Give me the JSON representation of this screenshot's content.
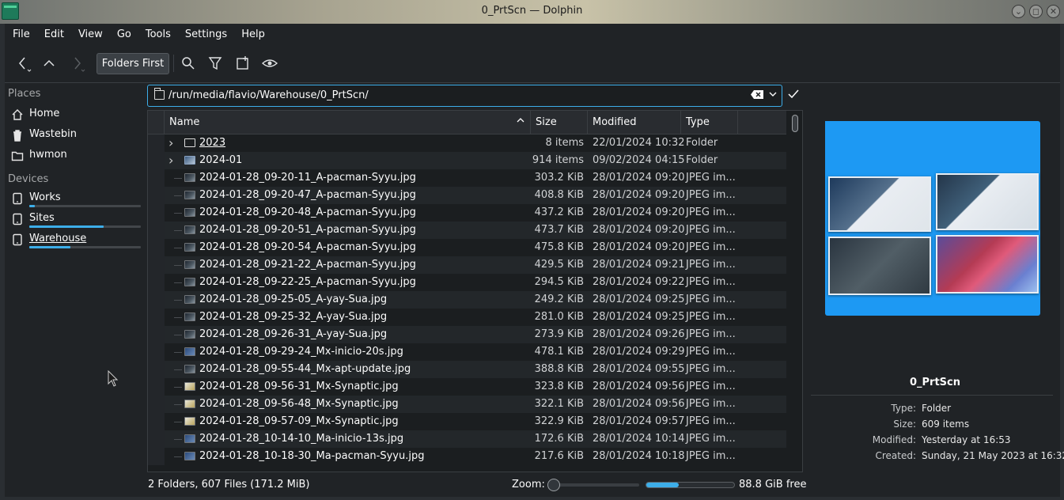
{
  "window": {
    "title": "0_PrtScn — Dolphin",
    "controls": [
      "minimize",
      "maximize",
      "close"
    ]
  },
  "menu": [
    "File",
    "Edit",
    "View",
    "Go",
    "Tools",
    "Settings",
    "Help"
  ],
  "toolbar": {
    "folders_first_label": "Folders First",
    "icons": [
      "back-icon",
      "up-icon",
      "forward-icon",
      "search-icon",
      "filter-icon",
      "new-tab-icon",
      "preview-icon"
    ]
  },
  "places": {
    "places_header": "Places",
    "devices_header": "Devices",
    "items": [
      {
        "label": "Home",
        "icon": "home-icon"
      },
      {
        "label": "Wastebin",
        "icon": "trash-icon"
      },
      {
        "label": "hwmon",
        "icon": "folder-icon"
      }
    ],
    "devices": [
      {
        "label": "Works",
        "icon": "drive-icon",
        "used_fraction": 0.05
      },
      {
        "label": "Sites",
        "icon": "drive-icon",
        "used_fraction": 0.67
      },
      {
        "label": "Warehouse",
        "icon": "drive-icon",
        "used_fraction": 0.37
      }
    ]
  },
  "location": {
    "path": "/run/media/flavio/Warehouse/0_PrtScn/"
  },
  "columns": {
    "name": "Name",
    "size": "Size",
    "modified": "Modified",
    "type": "Type"
  },
  "files": [
    {
      "name": "2023",
      "size": "8 items",
      "modified": "22/01/2024 10:32",
      "type": "Folder",
      "kind": "folder",
      "expandable": true
    },
    {
      "name": "2024-01",
      "size": "914 items",
      "modified": "09/02/2024 04:15",
      "type": "Folder",
      "kind": "folder-image",
      "expandable": true
    },
    {
      "name": "2024-01-28_09-20-11_A-pacman-Syyu.jpg",
      "size": "303.2 KiB",
      "modified": "28/01/2024 09:20",
      "type": "JPEG im...",
      "kind": "img"
    },
    {
      "name": "2024-01-28_09-20-47_A-pacman-Syyu.jpg",
      "size": "408.8 KiB",
      "modified": "28/01/2024 09:20",
      "type": "JPEG im...",
      "kind": "img"
    },
    {
      "name": "2024-01-28_09-20-48_A-pacman-Syyu.jpg",
      "size": "437.2 KiB",
      "modified": "28/01/2024 09:20",
      "type": "JPEG im...",
      "kind": "img"
    },
    {
      "name": "2024-01-28_09-20-51_A-pacman-Syyu.jpg",
      "size": "473.7 KiB",
      "modified": "28/01/2024 09:20",
      "type": "JPEG im...",
      "kind": "img"
    },
    {
      "name": "2024-01-28_09-20-54_A-pacman-Syyu.jpg",
      "size": "475.8 KiB",
      "modified": "28/01/2024 09:20",
      "type": "JPEG im...",
      "kind": "img"
    },
    {
      "name": "2024-01-28_09-21-22_A-pacman-Syyu.jpg",
      "size": "429.5 KiB",
      "modified": "28/01/2024 09:21",
      "type": "JPEG im...",
      "kind": "img"
    },
    {
      "name": "2024-01-28_09-22-25_A-pacman-Syyu.jpg",
      "size": "294.5 KiB",
      "modified": "28/01/2024 09:22",
      "type": "JPEG im...",
      "kind": "img"
    },
    {
      "name": "2024-01-28_09-25-05_A-yay-Sua.jpg",
      "size": "249.2 KiB",
      "modified": "28/01/2024 09:25",
      "type": "JPEG im...",
      "kind": "img"
    },
    {
      "name": "2024-01-28_09-25-32_A-yay-Sua.jpg",
      "size": "281.0 KiB",
      "modified": "28/01/2024 09:25",
      "type": "JPEG im...",
      "kind": "img"
    },
    {
      "name": "2024-01-28_09-26-31_A-yay-Sua.jpg",
      "size": "273.9 KiB",
      "modified": "28/01/2024 09:26",
      "type": "JPEG im...",
      "kind": "img"
    },
    {
      "name": "2024-01-28_09-29-24_Mx-inicio-20s.jpg",
      "size": "478.1 KiB",
      "modified": "28/01/2024 09:29",
      "type": "JPEG im...",
      "kind": "imgb"
    },
    {
      "name": "2024-01-28_09-55-44_Mx-apt-update.jpg",
      "size": "388.8 KiB",
      "modified": "28/01/2024 09:55",
      "type": "JPEG im...",
      "kind": "img"
    },
    {
      "name": "2024-01-28_09-56-31_Mx-Synaptic.jpg",
      "size": "323.8 KiB",
      "modified": "28/01/2024 09:56",
      "type": "JPEG im...",
      "kind": "imgl"
    },
    {
      "name": "2024-01-28_09-56-48_Mx-Synaptic.jpg",
      "size": "322.1 KiB",
      "modified": "28/01/2024 09:56",
      "type": "JPEG im...",
      "kind": "imgl"
    },
    {
      "name": "2024-01-28_09-57-09_Mx-Synaptic.jpg",
      "size": "322.9 KiB",
      "modified": "28/01/2024 09:57",
      "type": "JPEG im...",
      "kind": "imgl"
    },
    {
      "name": "2024-01-28_10-14-10_Ma-inicio-13s.jpg",
      "size": "172.6 KiB",
      "modified": "28/01/2024 10:14",
      "type": "JPEG im...",
      "kind": "imgb"
    },
    {
      "name": "2024-01-28_10-18-30_Ma-pacman-Syyu.jpg",
      "size": "217.6 KiB",
      "modified": "28/01/2024 10:18",
      "type": "JPEG im...",
      "kind": "imgb"
    }
  ],
  "preview": {
    "name": "0_PrtScn",
    "meta": [
      {
        "key": "Type:",
        "value": "Folder"
      },
      {
        "key": "Size:",
        "value": "609 items"
      },
      {
        "key": "Modified:",
        "value": "Yesterday at 16:53"
      },
      {
        "key": "Created:",
        "value": "Sunday, 21 May 2023 at 16:32"
      }
    ]
  },
  "status": {
    "summary": "2 Folders, 607 Files (171.2 MiB)",
    "zoom_label": "Zoom:",
    "zoom_level": 0.0,
    "free_space": "88.8 GiB free",
    "space_used_fraction": 0.37
  },
  "colors": {
    "accent": "#3daee9",
    "window_bg": "#202326",
    "view_bg": "#1b1e20"
  }
}
